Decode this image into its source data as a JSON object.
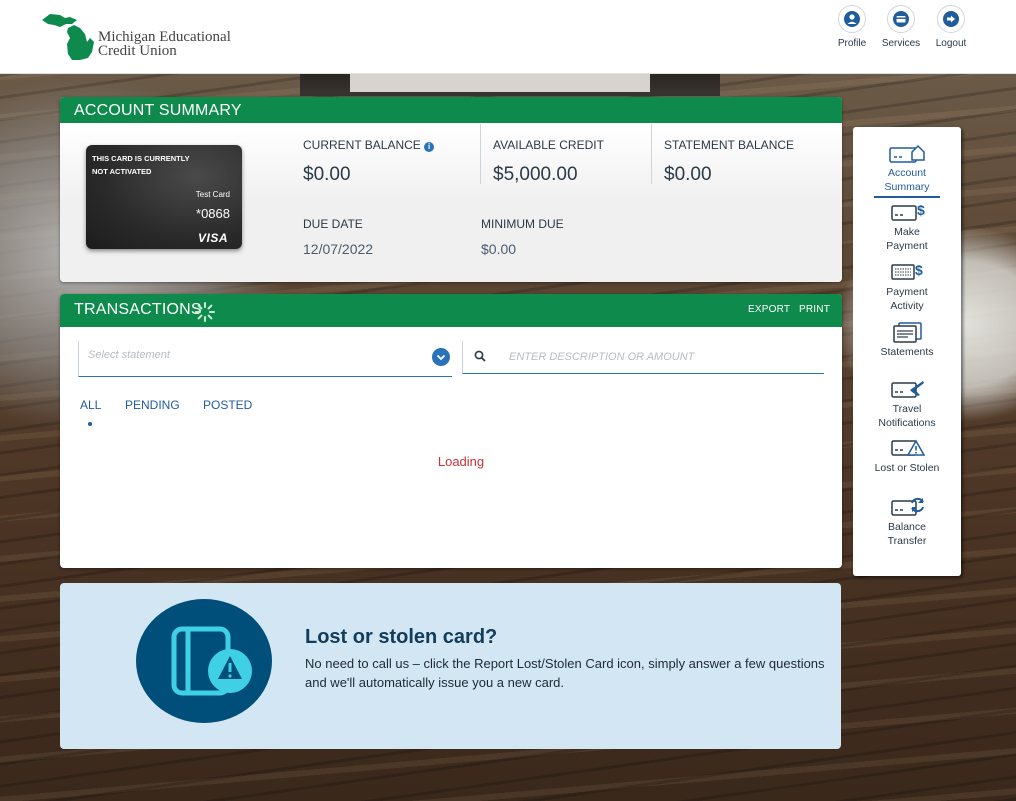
{
  "brand": {
    "name_line1": "Michigan Educational",
    "name_line2": "Credit Union",
    "color": "#0e8a4d"
  },
  "header": {
    "profile_label": "Profile",
    "services_label": "Services",
    "logout_label": "Logout"
  },
  "summary": {
    "title": "ACCOUNT SUMMARY",
    "card": {
      "status_line1": "THIS CARD IS CURRENTLY",
      "status_line2": "NOT ACTIVATED",
      "name": "Test Card",
      "number": "*0868",
      "network": "VISA"
    },
    "current_balance_label": "CURRENT BALANCE",
    "current_balance_value": "$0.00",
    "available_credit_label": "AVAILABLE CREDIT",
    "available_credit_value": "$5,000.00",
    "statement_balance_label": "STATEMENT BALANCE",
    "statement_balance_value": "$0.00",
    "due_date_label": "DUE DATE",
    "due_date_value": "12/07/2022",
    "minimum_due_label": "MINIMUM DUE",
    "minimum_due_value": "$0.00"
  },
  "transactions": {
    "title": "TRANSACTIONS",
    "export_label": "EXPORT",
    "print_label": "PRINT",
    "statement_placeholder": "Select statement",
    "search_placeholder": "ENTER DESCRIPTION OR AMOUNT",
    "tabs": [
      {
        "label": "ALL"
      },
      {
        "label": "PENDING"
      },
      {
        "label": "POSTED"
      }
    ],
    "loading_text": "Loading"
  },
  "sidenav": {
    "items": [
      {
        "line1": "Account",
        "line2": "Summary"
      },
      {
        "line1": "Make",
        "line2": "Payment"
      },
      {
        "line1": "Payment",
        "line2": "Activity"
      },
      {
        "line1": "Statements",
        "line2": ""
      },
      {
        "line1": "Travel",
        "line2": "Notifications"
      },
      {
        "line1": "Lost or Stolen",
        "line2": ""
      },
      {
        "line1": "Balance",
        "line2": "Transfer"
      }
    ]
  },
  "promo": {
    "title": "Lost or stolen card?",
    "text": "No need to call us – click the Report Lost/Stolen Card icon, simply answer a few questions and we'll automatically issue you a new card."
  },
  "colors": {
    "primary_green": "#0e8a4d",
    "link_blue": "#1f5c9c",
    "loading_red": "#c8323c",
    "promo_bg": "#d2e6f3",
    "promo_circle": "#004f7a",
    "promo_icon": "#3fd0e6"
  }
}
